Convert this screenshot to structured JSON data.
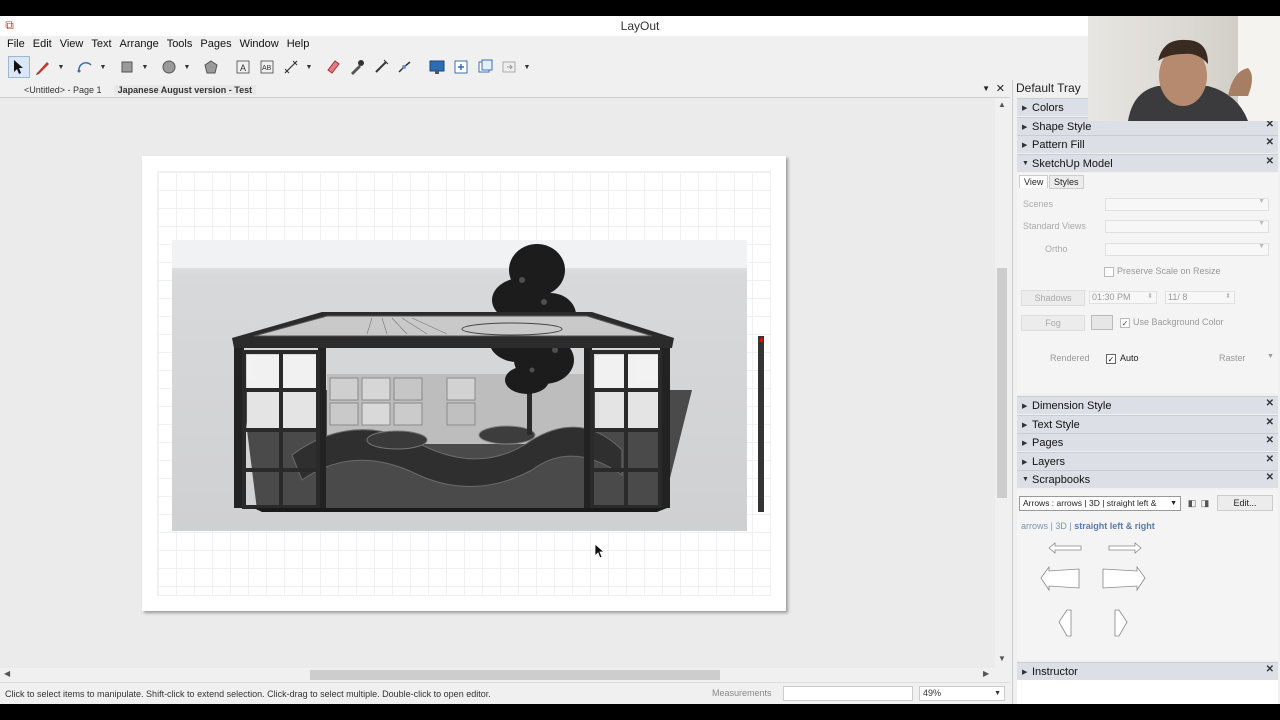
{
  "window": {
    "title": "LayOut"
  },
  "menu": [
    "File",
    "Edit",
    "View",
    "Text",
    "Arrange",
    "Tools",
    "Pages",
    "Window",
    "Help"
  ],
  "doc_tabs": [
    {
      "label": "<Untitled> - Page 1",
      "active": false
    },
    {
      "label": "Japanese August version - Test",
      "active": true
    }
  ],
  "status": {
    "hint": "Click to select items to manipulate. Shift-click to extend selection. Click-drag to select multiple. Double-click to open editor.",
    "measurements_label": "Measurements",
    "measurements_value": "",
    "zoom": "49%"
  },
  "tray": {
    "title": "Default Tray",
    "panels": {
      "colors": "Colors",
      "shape_style": "Shape Style",
      "pattern_fill": "Pattern Fill",
      "sketchup_model": "SketchUp Model",
      "dimension_style": "Dimension Style",
      "text_style": "Text Style",
      "pages": "Pages",
      "layers": "Layers",
      "scrapbooks": "Scrapbooks",
      "instructor": "Instructor"
    },
    "sketchup": {
      "tab_view": "View",
      "tab_styles": "Styles",
      "scenes_label": "Scenes",
      "standard_views_label": "Standard Views",
      "ortho_label": "Ortho",
      "preserve_scale": "Preserve Scale on Resize",
      "shadows_label": "Shadows",
      "shadow_time": "01:30 PM",
      "shadow_date": "11/ 8",
      "fog_label": "Fog",
      "use_bg_color": "Use Background Color",
      "rendered_label": "Rendered",
      "auto_label": "Auto",
      "auto_checked": true,
      "raster_label": "Raster"
    },
    "scrapbook": {
      "selected": "Arrows : arrows | 3D | straight left &",
      "edit_label": "Edit...",
      "crumb_prefix": "arrows | 3D |",
      "crumb_current": "straight left & right"
    }
  },
  "colors": {
    "accent": "#dbe7f5",
    "panel_header": "#dcdfe5",
    "canvas": "#ebebeb"
  }
}
